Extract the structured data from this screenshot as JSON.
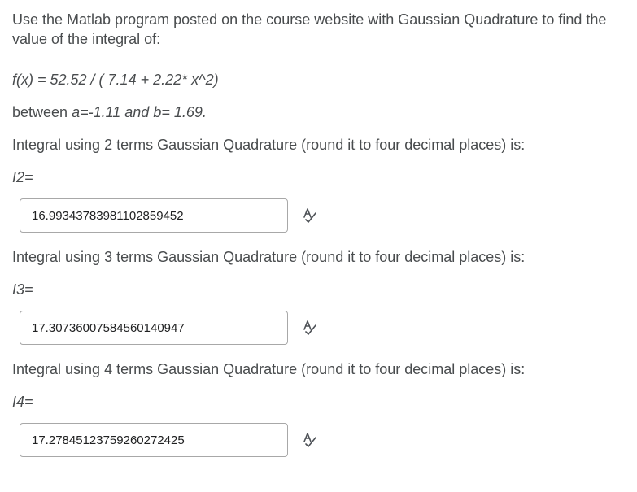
{
  "question": {
    "intro": "Use the Matlab program posted on the course website with Gaussian Quadrature to find the value of the integral of:",
    "formula": "f(x) = 52.52 / ( 7.14 + 2.22* x^2)",
    "interval_prefix": "between ",
    "interval_a": "a=-1.11",
    "interval_mid": " and ",
    "interval_b": "b= 1.69."
  },
  "parts": [
    {
      "prompt": "Integral using 2 terms Gaussian Quadrature (round it to four decimal places) is:",
      "label": "I2=",
      "value": "16.99343783981102859452",
      "icon": "spell-check-icon"
    },
    {
      "prompt": "Integral using 3 terms Gaussian Quadrature (round it to four decimal places) is:",
      "label": "I3=",
      "value": "17.30736007584560140947",
      "icon": "spell-check-icon"
    },
    {
      "prompt": "Integral using 4 terms Gaussian Quadrature (round it to four decimal places) is:",
      "label": "I4=",
      "value": "17.27845123759260272425",
      "icon": "spell-check-icon"
    }
  ],
  "colors": {
    "text": "#494c4e",
    "input_border": "#a8a8a8",
    "icon": "#4d5156"
  }
}
